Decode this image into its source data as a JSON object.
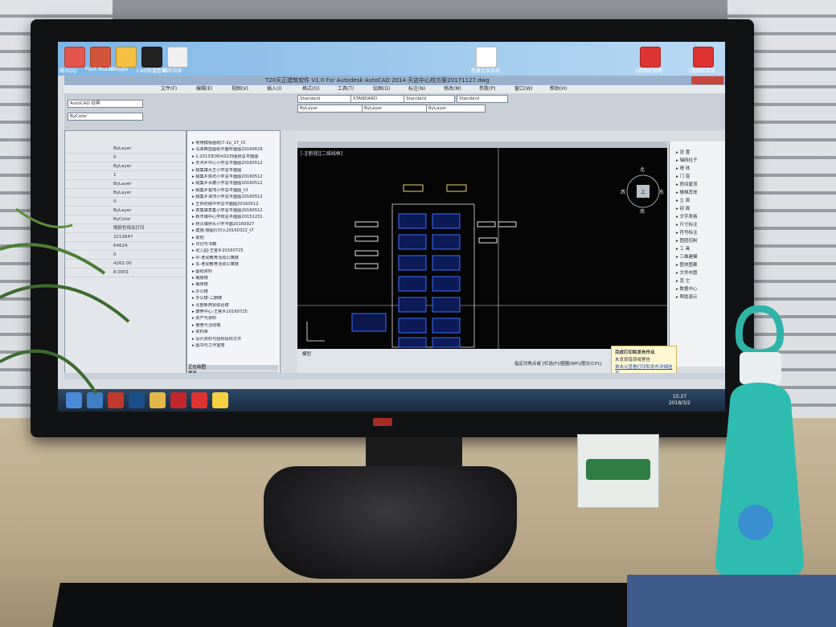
{
  "scene": {
    "title_bar_text": "T20天正建筑软件 V1.0 For Autodesk AutoCAD 2014    天店中心校方案20171127.dwg",
    "cad_model_tab": "模型",
    "cad_view_label": "[-][俯视][二维线框]",
    "viewcube": {
      "north": "北",
      "south": "南",
      "west": "西",
      "east": "东",
      "center": "上"
    },
    "notification": {
      "title": "完成打印和发布作业",
      "line1": "未发现错误或警告",
      "line2": "单击以查看打印和发布详细信息..."
    },
    "clock": {
      "time": "15:27",
      "date": "2018/3/2"
    }
  },
  "desktop_icons": [
    {
      "label": "腾讯QQ",
      "color": "#e3554d"
    },
    {
      "label": "Foxit Reader",
      "color": "#d4553a"
    },
    {
      "label": "Google",
      "color": "#f4c044"
    },
    {
      "label": "CAD快速看图",
      "color": "#222"
    },
    {
      "label": "福昕阅读",
      "color": "#f0f0f0"
    },
    {
      "label": "新建文本文档",
      "color": "#ffffff"
    },
    {
      "label": "1期图纸说明",
      "color": "#d33"
    },
    {
      "label": "1期图纸目录",
      "color": "#d33"
    }
  ],
  "menus": [
    "文件(F)",
    "编辑(E)",
    "视图(V)",
    "插入(I)",
    "格式(O)",
    "工具(T)",
    "绘图(D)",
    "标注(N)",
    "修改(M)",
    "参数(P)",
    "窗口(W)",
    "帮助(H)"
  ],
  "toolbar": {
    "combos": [
      "AutoCAD 经典",
      "Standard",
      "STANDARD",
      "Standard",
      "Standard",
      "ByLayer",
      "ByLayer",
      "ByLayer",
      "ByColor"
    ],
    "style_label": "Standard"
  },
  "properties": {
    "rows": [
      "ByLayer",
      "0",
      "ByLayer",
      "1",
      "ByLayer",
      "ByLayer",
      "0",
      "ByLayer",
      "ByColor",
      "随颜色相关打印",
      "3213647",
      "64624",
      "0",
      "4262.00",
      "8.0001"
    ]
  },
  "design_tree": {
    "items": [
      "常用模板图纸\\7-2p_17_t3",
      "马来西亚图纸平面布置图20160616",
      "1:2013年06月02日图纸总平面图",
      "天河乡中心小学总平面图20160512",
      "姚集镇大王小学总平面图",
      "姚集乡陈坊小学总平面图20160512",
      "姚集乡水磨小学总平面图20160512",
      "姚集乡曹湾小学总平面图_t3",
      "姚集乡潭湾小学总平面图20160512",
      "王桥初级中学总平面图20160512",
      "袁集镇袁集小学总平面图20160512",
      "新市镇中心学校总平面图20151231",
      "桥头镇桥头小学平面20160927",
      "建施-施图打印入20160322_t7",
      "其他",
      "日记与书籍",
      "幼儿园-王官乡20160725",
      "中-老幼教育活动公寓楼",
      "东-老幼教育活动公寓楼",
      "图纸资料",
      "病房楼",
      "病床楼",
      "办公楼",
      "办公楼-二期楼",
      "北部新商贸综合楼",
      "康养中心-王官乡20160725",
      "资产与资料",
      "宿舍与活动楼",
      "资料库",
      "设计资料与招标投标文件",
      "图书与工作室楼"
    ],
    "footer1": "正在绘图",
    "footer2": "预览"
  },
  "right_palette": [
    "设 置",
    "轴网柱子",
    "墙 体",
    "门 窗",
    "房间屋顶",
    "楼梯其他",
    "立 面",
    "剖 面",
    "文字表格",
    "尺寸标注",
    "符号标注",
    "图层控制",
    "工 具",
    "三维建模",
    "图块图案",
    "文件布图",
    "其 它",
    "数据中心",
    "帮助演示"
  ],
  "taskbar_apps": [
    {
      "name": "start",
      "color": "#4a8ad6"
    },
    {
      "name": "ie",
      "color": "#3c7fc4"
    },
    {
      "name": "autocad",
      "color": "#c0392b"
    },
    {
      "name": "photoshop",
      "color": "#1b4f8a"
    },
    {
      "name": "explorer",
      "color": "#e2b84a"
    },
    {
      "name": "acrobat",
      "color": "#c1272d"
    },
    {
      "name": "pdf",
      "color": "#d33"
    },
    {
      "name": "paint",
      "color": "#f5d142"
    }
  ],
  "cmd_text": "指定对角点或 [栏选(F)/圈围(WP)/圈交(CP)]:"
}
